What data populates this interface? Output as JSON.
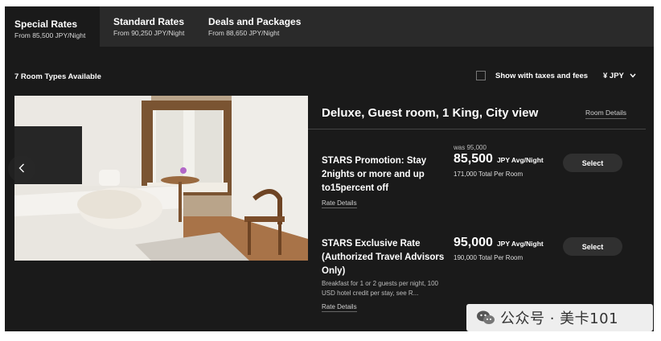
{
  "tabs": [
    {
      "title": "Special Rates",
      "subtitle": "From 85,500 JPY/Night",
      "active": true
    },
    {
      "title": "Standard Rates",
      "subtitle": "From 90,250 JPY/Night",
      "active": false
    },
    {
      "title": "Deals and Packages",
      "subtitle": "From 88,650 JPY/Night",
      "active": false
    }
  ],
  "toolbar": {
    "room_count": "7 Room Types Available",
    "tax_label": "Show with taxes and fees",
    "currency": "¥ JPY"
  },
  "room": {
    "title": "Deluxe, Guest room, 1 King, City view",
    "details_link": "Room Details"
  },
  "rates": [
    {
      "name": "STARS Promotion: Stay 2nights or more and up to15percent off",
      "was": "was 95,000",
      "price": "85,500",
      "per": "JPY Avg/Night",
      "total": "171,000 Total Per Room",
      "details_link": "Rate Details",
      "select_label": "Select"
    },
    {
      "name": "STARS Exclusive Rate (Authorized Travel Advisors Only)",
      "description": "Breakfast for 1 or 2 guests per night, 100 USD hotel credit per stay, see R...",
      "price": "95,000",
      "per": "JPY Avg/Night",
      "total": "190,000 Total Per Room",
      "details_link": "Rate Details",
      "select_label": "Select"
    }
  ],
  "watermark": {
    "text": "公众号 · 美卡101",
    "icon": "wechat-icon"
  },
  "icons": {
    "carousel_prev": "chevron-left-icon",
    "currency_dropdown": "chevron-down-icon"
  },
  "colors": {
    "background": "#1a1a1a",
    "tab_bar": "#2a2a2a",
    "button": "#303030"
  }
}
